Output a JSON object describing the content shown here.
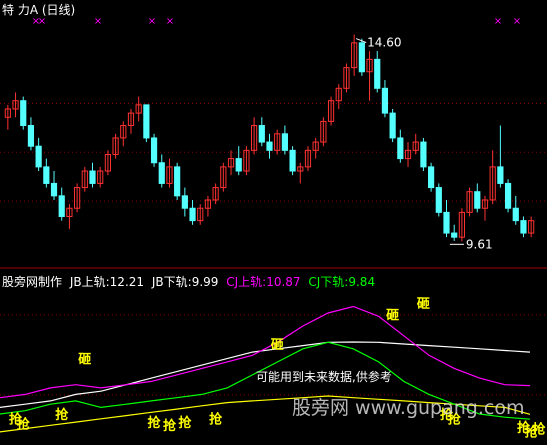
{
  "header": {
    "title_prefix": "特  力",
    "title_code": "A",
    "period": "(日线)"
  },
  "price_panel": {
    "high_label": "14.60",
    "low_label": "9.61",
    "ylim": [
      9.1,
      15.0
    ],
    "marker_color": "#ff00ff",
    "up_color": "#ff3232",
    "down_color": "#54ffff",
    "grid_color": "#8b0000"
  },
  "indicator_panel": {
    "name": "股旁网制作",
    "jb_upper_label": "JB上轨:",
    "jb_upper_value": "12.21",
    "jb_lower_label": "JB下轨:",
    "jb_lower_value": "9.99",
    "cj_upper_label": "CJ上轨:",
    "cj_upper_value": "10.87",
    "cj_lower_label": "CJ下轨:",
    "cj_lower_value": "9.84",
    "note": "可能用到未来数据,供参考",
    "sell_signal": "砸",
    "buy_signal": "抢",
    "watermark": "股旁网 www.gupang.com",
    "colors": {
      "jb_upper": "#ffffff",
      "jb_lower": "#ffff00",
      "cj_upper": "#ff00ff",
      "cj_lower": "#00ff00",
      "signal": "#ffff00",
      "note": "#ffffff"
    }
  },
  "chart_data": {
    "type": "candlestick",
    "candles": [
      [
        12.6,
        12.9,
        12.3,
        12.8
      ],
      [
        12.8,
        13.2,
        12.6,
        13.0
      ],
      [
        13.0,
        13.1,
        12.3,
        12.4
      ],
      [
        12.4,
        12.6,
        11.8,
        11.9
      ],
      [
        11.9,
        12.1,
        11.3,
        11.4
      ],
      [
        11.4,
        11.6,
        10.9,
        11.0
      ],
      [
        11.0,
        11.3,
        10.6,
        10.7
      ],
      [
        10.7,
        10.9,
        10.1,
        10.2
      ],
      [
        10.2,
        10.5,
        9.9,
        10.4
      ],
      [
        10.4,
        11.0,
        10.3,
        10.9
      ],
      [
        10.9,
        11.4,
        10.8,
        11.3
      ],
      [
        11.3,
        11.5,
        10.9,
        11.0
      ],
      [
        11.0,
        11.4,
        10.9,
        11.3
      ],
      [
        11.3,
        11.8,
        11.2,
        11.7
      ],
      [
        11.7,
        12.2,
        11.6,
        12.1
      ],
      [
        12.1,
        12.5,
        11.9,
        12.4
      ],
      [
        12.4,
        12.8,
        12.2,
        12.7
      ],
      [
        12.7,
        13.1,
        12.5,
        12.9
      ],
      [
        12.9,
        12.9,
        12.0,
        12.1
      ],
      [
        12.1,
        12.2,
        11.4,
        11.5
      ],
      [
        11.5,
        11.7,
        10.9,
        11.0
      ],
      [
        11.0,
        11.6,
        10.9,
        11.4
      ],
      [
        11.4,
        11.5,
        10.6,
        10.7
      ],
      [
        10.7,
        10.9,
        10.2,
        10.4
      ],
      [
        10.4,
        10.6,
        10.0,
        10.1
      ],
      [
        10.1,
        10.5,
        10.0,
        10.4
      ],
      [
        10.4,
        10.7,
        10.2,
        10.6
      ],
      [
        10.6,
        11.0,
        10.5,
        10.9
      ],
      [
        10.9,
        11.5,
        10.8,
        11.4
      ],
      [
        11.4,
        11.8,
        11.2,
        11.6
      ],
      [
        11.6,
        11.9,
        11.2,
        11.3
      ],
      [
        11.3,
        11.9,
        11.2,
        11.8
      ],
      [
        11.8,
        12.6,
        11.7,
        12.4
      ],
      [
        12.4,
        12.6,
        11.9,
        12.0
      ],
      [
        12.0,
        12.2,
        11.6,
        11.8
      ],
      [
        11.8,
        12.3,
        11.7,
        12.2
      ],
      [
        12.2,
        12.4,
        11.7,
        11.8
      ],
      [
        11.8,
        11.9,
        11.2,
        11.3
      ],
      [
        11.3,
        11.5,
        11.0,
        11.4
      ],
      [
        11.4,
        11.9,
        11.3,
        11.8
      ],
      [
        11.8,
        12.1,
        11.6,
        12.0
      ],
      [
        12.0,
        12.6,
        11.9,
        12.5
      ],
      [
        12.5,
        13.1,
        12.4,
        13.0
      ],
      [
        13.0,
        13.4,
        12.8,
        13.3
      ],
      [
        13.3,
        13.9,
        13.2,
        13.8
      ],
      [
        13.8,
        14.6,
        13.6,
        14.4
      ],
      [
        14.4,
        14.5,
        13.6,
        13.7
      ],
      [
        13.7,
        14.2,
        13.0,
        14.0
      ],
      [
        14.0,
        14.2,
        13.2,
        13.3
      ],
      [
        13.3,
        13.5,
        12.6,
        12.7
      ],
      [
        12.7,
        12.8,
        12.0,
        12.1
      ],
      [
        12.1,
        12.3,
        11.5,
        11.6
      ],
      [
        11.6,
        12.0,
        11.4,
        11.8
      ],
      [
        11.8,
        12.2,
        11.7,
        12.0
      ],
      [
        12.0,
        12.1,
        11.3,
        11.4
      ],
      [
        11.4,
        11.5,
        10.8,
        10.9
      ],
      [
        10.9,
        11.0,
        10.2,
        10.3
      ],
      [
        10.3,
        10.6,
        9.7,
        9.8
      ],
      [
        9.8,
        10.0,
        9.61,
        9.7
      ],
      [
        9.7,
        10.4,
        9.6,
        10.3
      ],
      [
        10.3,
        10.9,
        10.2,
        10.8
      ],
      [
        10.8,
        11.0,
        10.3,
        10.4
      ],
      [
        10.4,
        10.7,
        10.1,
        10.6
      ],
      [
        10.6,
        11.8,
        10.5,
        11.4
      ],
      [
        11.4,
        12.4,
        10.9,
        11.0
      ],
      [
        11.0,
        11.1,
        10.3,
        10.4
      ],
      [
        10.4,
        10.7,
        10.0,
        10.1
      ],
      [
        10.1,
        10.2,
        9.7,
        9.8
      ],
      [
        9.8,
        10.2,
        9.7,
        10.1
      ]
    ],
    "series": [
      {
        "name": "JB上轨",
        "values": [
          10.2,
          10.3,
          10.4,
          10.6,
          10.7,
          10.9,
          11.1,
          11.3,
          11.5,
          11.7,
          11.9,
          12.0,
          12.1,
          12.2,
          12.21,
          12.2,
          12.15,
          12.1,
          12.05,
          12.0,
          11.95,
          11.9
        ]
      },
      {
        "name": "JB下轨",
        "values": [
          9.45,
          9.55,
          9.65,
          9.75,
          9.85,
          9.95,
          10.05,
          10.15,
          10.25,
          10.35,
          10.4,
          10.45,
          10.5,
          10.55,
          10.5,
          10.45,
          10.4,
          10.35,
          10.3,
          10.25,
          10.2,
          9.99
        ]
      },
      {
        "name": "CJ上轨",
        "values": [
          10.5,
          10.6,
          10.8,
          10.9,
          10.8,
          10.9,
          11.0,
          11.2,
          11.4,
          11.6,
          11.8,
          12.2,
          12.7,
          13.1,
          13.3,
          13.0,
          12.4,
          11.8,
          11.4,
          11.1,
          10.9,
          10.87
        ]
      },
      {
        "name": "CJ下轨",
        "values": [
          10.0,
          10.1,
          10.3,
          10.4,
          10.2,
          10.3,
          10.4,
          10.5,
          10.6,
          10.8,
          11.2,
          11.6,
          12.0,
          12.2,
          12.0,
          11.6,
          11.0,
          10.6,
          10.3,
          10.0,
          9.9,
          9.84
        ]
      }
    ],
    "ylim": [
      9.2,
      13.5
    ],
    "signals": [
      {
        "text": "砸",
        "x": 10,
        "y": 11.55
      },
      {
        "text": "砸",
        "x": 35,
        "y": 12.0
      },
      {
        "text": "砸",
        "x": 50,
        "y": 12.9
      },
      {
        "text": "砸",
        "x": 54,
        "y": 13.25
      },
      {
        "text": "砸",
        "x": 79,
        "y": 10.9
      },
      {
        "text": "抢",
        "x": 1,
        "y": 9.7
      },
      {
        "text": "抢",
        "x": 2,
        "y": 9.55
      },
      {
        "text": "抢",
        "x": 7,
        "y": 9.85
      },
      {
        "text": "抢",
        "x": 19,
        "y": 9.6
      },
      {
        "text": "抢",
        "x": 21,
        "y": 9.5
      },
      {
        "text": "抢",
        "x": 23,
        "y": 9.6
      },
      {
        "text": "抢",
        "x": 27,
        "y": 9.7
      },
      {
        "text": "抢",
        "x": 57,
        "y": 9.85
      },
      {
        "text": "抢",
        "x": 58,
        "y": 9.7
      },
      {
        "text": "抢",
        "x": 67,
        "y": 9.45
      },
      {
        "text": "抢",
        "x": 68,
        "y": 9.3
      },
      {
        "text": "抢",
        "x": 69,
        "y": 9.4
      },
      {
        "text": "抢",
        "x": 73,
        "y": 9.3
      },
      {
        "text": "抢",
        "x": 80,
        "y": 9.4
      }
    ]
  }
}
